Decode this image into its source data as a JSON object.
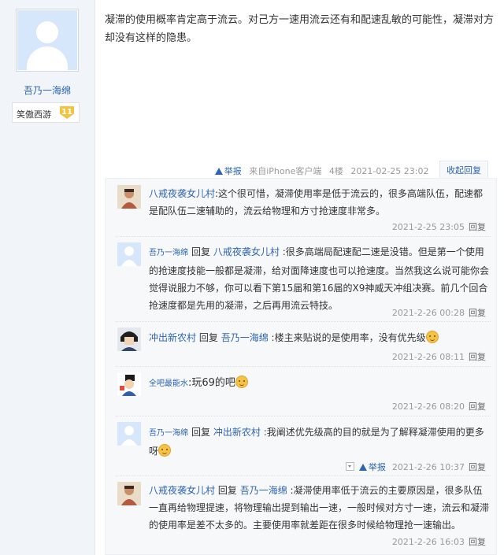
{
  "author": {
    "name": "吾乃一海绵",
    "forum_badge": "笑傲西游",
    "level": "11"
  },
  "post": {
    "text": "凝滞的使用概率肯定高于流云。对己方一速用流云还有和配速乱敏的可能性，凝滞对方却没有这样的隐患。",
    "report": "举报",
    "source": "来自iPhone客户端",
    "floor": "4楼",
    "time": "2021-02-25 23:02",
    "collapse": "收起回复"
  },
  "replies": [
    {
      "author": "八戒夜袭女儿村",
      "reply_word": "",
      "target": "",
      "text": ":这个很可惜，凝滞使用率是低于流云的，很多高端队伍，配速都是配队伍二速辅助的，流云给物理和方寸抢速度非常多。",
      "time": "2021-2-25 23:05",
      "action": "回复"
    },
    {
      "author": "吾乃一海绵",
      "reply_word": "回复",
      "target": "八戒夜袭女儿村",
      "text": ":很多高端局配速配二速是没错。但是第一个使用的抢速度技能一般都是凝滞，给对面降速度也可以抢速度。当然我这么说可能你会觉得说服力不够，你可以看下第15届和第16届的X9神威天冲组决赛。前几个回合抢速度都是先用的凝滞，之后再用流云特技。",
      "time": "2021-2-26 00:28",
      "action": "回复"
    },
    {
      "author": "冲出新农村",
      "reply_word": "回复",
      "target": "吾乃一海绵",
      "text": ":楼主来贴说的是使用率，没有优先级",
      "time": "2021-2-26 08:11",
      "action": "回复"
    },
    {
      "author": "全吧最能水",
      "reply_word": "",
      "target": "",
      "text": ":玩69的吧",
      "time": "2021-2-26 08:20",
      "action": "回复"
    },
    {
      "author": "吾乃一海绵",
      "reply_word": "回复",
      "target": "冲出新农村",
      "text": ":我阐述优先级高的目的就是为了解释凝滞使用的更多呀",
      "time": "2021-2-26 10:37",
      "action": "回复",
      "report": "举报"
    },
    {
      "author": "八戒夜袭女儿村",
      "reply_word": "回复",
      "target": "吾乃一海绵",
      "text": ":凝滞使用率低于流云的主要原因是，很多队伍一直再给物理提速，将物理输出提到输出一速，一般时候对方寸一速，流云和凝滞的使用率是差不太多的。主要使用率就差距在很多时候给物理抢一速输出。",
      "time": "2021-2-26 16:03",
      "action": "回复"
    }
  ]
}
